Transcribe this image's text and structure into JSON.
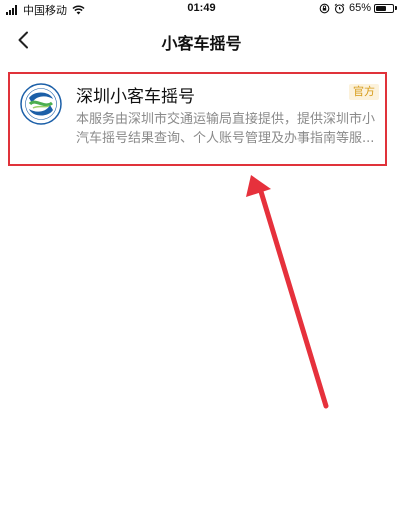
{
  "status_bar": {
    "carrier": "中国移动",
    "time": "01:49",
    "battery_percent": "65%",
    "battery_level": 0.65,
    "icons": [
      "signal-icon",
      "wifi-icon",
      "orientation-lock-icon",
      "alarm-icon",
      "battery-icon"
    ]
  },
  "nav": {
    "title": "小客车摇号",
    "back_icon": "chevron-left-icon"
  },
  "result": {
    "title": "深圳小客车摇号",
    "badge": "官方",
    "description": "本服务由深圳市交通运输局直接提供，提供深圳市小汽车摇号结果查询、个人账号管理及办事指南等服...",
    "logo_icon": "shenzhen-transport-logo-icon"
  },
  "colors": {
    "highlight_border": "#e0323a",
    "badge_text": "#d69a16",
    "badge_bg": "#fcf2dc",
    "description_text": "#8a8a8a",
    "arrow": "#e6313c"
  }
}
